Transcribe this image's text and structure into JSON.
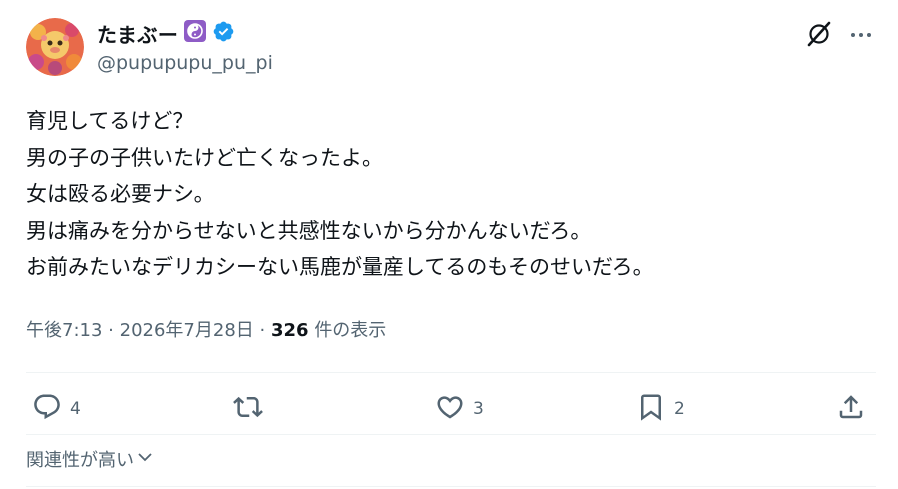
{
  "user": {
    "display_name": "たまぶー",
    "handle": "@pupupupu_pu_pi",
    "verified_color": "#1d9bf0",
    "badge_color": "#8e5cc6"
  },
  "post": {
    "lines": [
      "育児してるけど？",
      "男の子の子供いたけど亡くなったよ。",
      "女は殴る必要ナシ。",
      "男は痛みを分からせないと共感性ないから分かんないだろ。",
      "お前みたいなデリカシーない馬鹿が量産してるのもそのせいだろ。"
    ],
    "time": "午後7:13",
    "separator": "·",
    "date": "2026年7月28日",
    "views_count": "326",
    "views_label": "件の表示"
  },
  "actions": {
    "replies": "4",
    "retweets": "",
    "likes": "3",
    "bookmarks": "2"
  },
  "icons": [
    "grok-icon",
    "more-icon",
    "reply-icon",
    "retweet-icon",
    "like-icon",
    "bookmark-icon",
    "share-icon",
    "chevron-down-icon",
    "verified-icon",
    "yin-yang-icon"
  ],
  "related": {
    "label": "関連性が高い"
  }
}
